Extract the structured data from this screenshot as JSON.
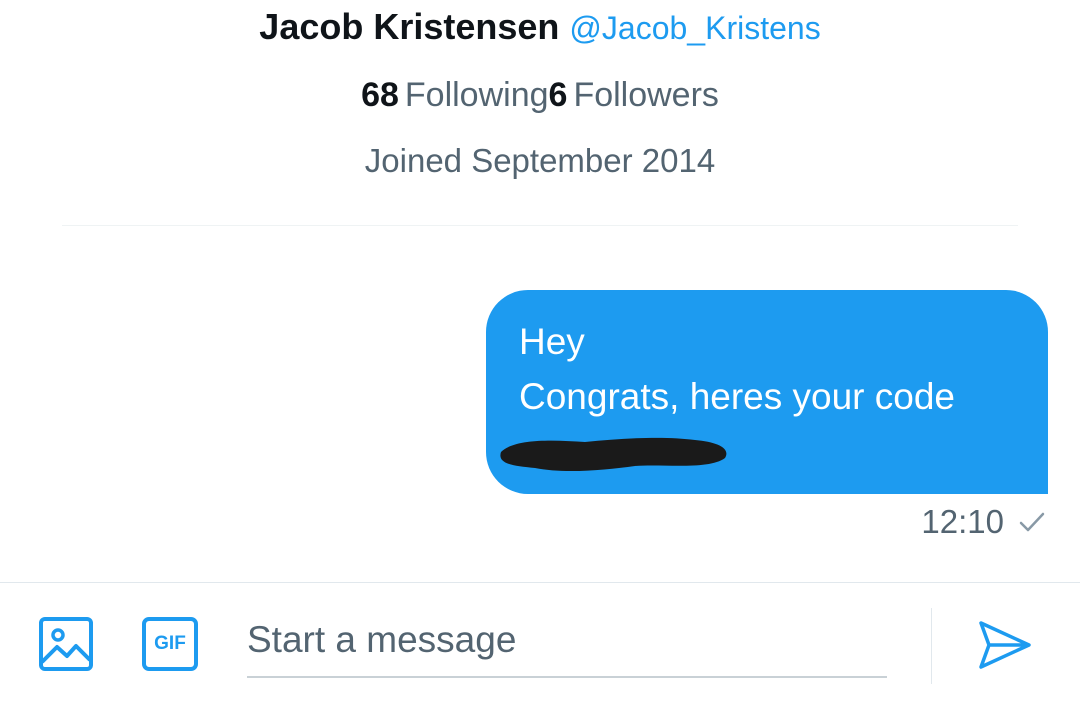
{
  "profile": {
    "display_name": "Jacob Kristensen",
    "handle": "@Jacob_Kristens",
    "following_count": "68",
    "following_label": "Following",
    "followers_count": "6",
    "followers_label": "Followers",
    "joined": "Joined September 2014"
  },
  "conversation": {
    "messages": [
      {
        "direction": "outgoing",
        "lines": [
          "Hey",
          "Congrats, heres your code"
        ],
        "code_redacted": true,
        "code_visible_fragment": "",
        "time": "12:10",
        "status_icon": "sent-check-icon"
      }
    ]
  },
  "composer": {
    "placeholder": "Start a message",
    "value": "",
    "media_icon": "image-icon",
    "gif_label": "GIF",
    "send_icon": "send-icon"
  },
  "colors": {
    "accent": "#1d9bf0",
    "text_primary": "#0f1419",
    "text_secondary": "#536471",
    "redaction": "#1a1a1a"
  }
}
